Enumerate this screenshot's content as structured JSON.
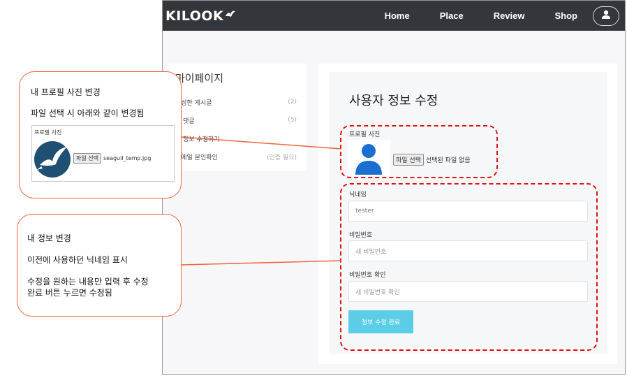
{
  "navbar": {
    "logo": "KILOOK",
    "links": [
      "Home",
      "Place",
      "Review",
      "Shop"
    ],
    "icons": {
      "logo_mark": "seagull-icon",
      "user": "user-icon"
    }
  },
  "sidebar": {
    "title": "마이페이지",
    "items": [
      {
        "label": "작성한 게시글",
        "count": "(2)"
      },
      {
        "label": "내 댓글",
        "count": "(5)"
      },
      {
        "label": "내 정보 수정하기",
        "count": ""
      },
      {
        "label": "이메일 본인확인",
        "count": "(인증 필요)"
      }
    ]
  },
  "form": {
    "title": "사용자 정보 수정",
    "profile_label": "프로필 사진",
    "file_button": "파일 선택",
    "file_status": "선택된 파일 없음",
    "nickname_label": "닉네임",
    "nickname_value": "tester",
    "password_label": "비밀번호",
    "password_placeholder": "새 비밀번호",
    "password_confirm_label": "비밀번호 확인",
    "password_confirm_placeholder": "새 비밀번호 확인",
    "submit_label": "정보 수정 완료"
  },
  "callout_photo": {
    "line1": "내 프로필 사진 변경",
    "line2": "파일 선택 시 아래와 같이 변경됨",
    "example_label": "프로필 사진",
    "example_button": "파일 선택",
    "example_filename": "seagull_temp.jpg"
  },
  "callout_info": {
    "line1": "내 정보 변경",
    "line2": "이전에 사용하던 닉네임 표시",
    "line3": "수정을 원하는 내용만 입력 후 수정",
    "line4": "완료 버튼 누르면 수정됨"
  },
  "colors": {
    "navbar": "#33363a",
    "submit": "#5bcde6",
    "highlight": "#e01010",
    "callout_border": "#f0643c",
    "avatar": "#1a6fd1"
  }
}
